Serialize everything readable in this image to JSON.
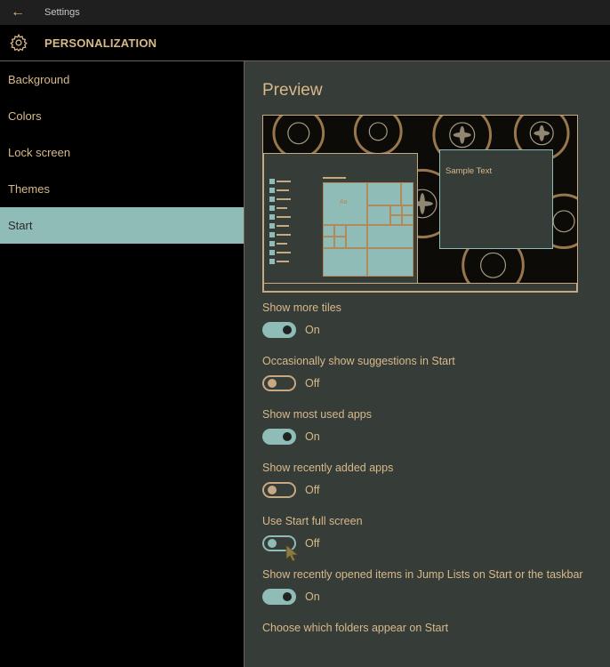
{
  "window": {
    "title": "Settings",
    "back_icon": "arrow-left-icon"
  },
  "header": {
    "title": "PERSONALIZATION",
    "icon": "gear-icon"
  },
  "sidebar": {
    "items": [
      {
        "label": "Background"
      },
      {
        "label": "Colors"
      },
      {
        "label": "Lock screen"
      },
      {
        "label": "Themes"
      },
      {
        "label": "Start"
      }
    ],
    "active_index": 4
  },
  "main": {
    "preview_title": "Preview",
    "preview": {
      "sample_text": "Sample Text",
      "tile_label": "Aa"
    },
    "settings": [
      {
        "label": "Show more tiles",
        "state": "On"
      },
      {
        "label": "Occasionally show suggestions in Start",
        "state": "Off"
      },
      {
        "label": "Show most used apps",
        "state": "On"
      },
      {
        "label": "Show recently added apps",
        "state": "Off"
      },
      {
        "label": "Use Start full screen",
        "state": "Off"
      },
      {
        "label": "Show recently opened items in Jump Lists on Start or the taskbar",
        "state": "On"
      }
    ],
    "folders_link": "Choose which folders appear on Start"
  },
  "colors": {
    "accent": "#8fbcb6",
    "text": "#d8b98a",
    "panel": "#363c38",
    "background": "#000000"
  }
}
